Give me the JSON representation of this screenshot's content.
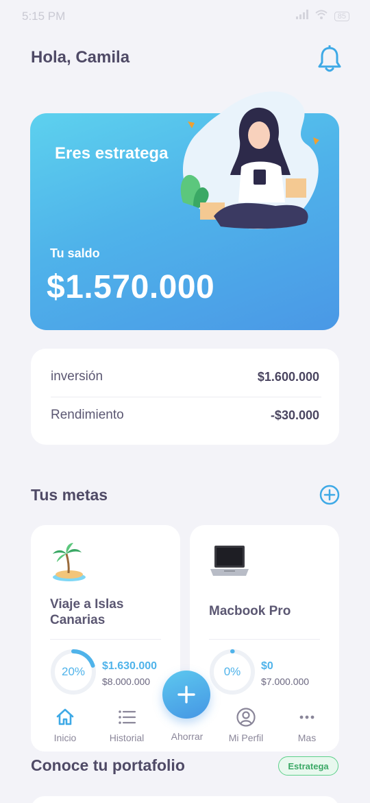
{
  "status": {
    "time": "5:15 PM",
    "battery": "85"
  },
  "header": {
    "greeting": "Hola, Camila"
  },
  "hero": {
    "title": "Eres estratega",
    "balance_label": "Tu saldo",
    "balance": "$1.570.000"
  },
  "summary": {
    "rows": [
      {
        "label": "inversión",
        "value": "$1.600.000"
      },
      {
        "label": "Rendimiento",
        "value": "-$30.000"
      }
    ]
  },
  "goals": {
    "title": "Tus metas",
    "items": [
      {
        "name": "Viaje a Islas Canarias",
        "icon": "island-icon",
        "percent": "20%",
        "progress": 0.2,
        "saved": "$1.630.000",
        "target": "$8.000.000"
      },
      {
        "name": "Macbook Pro",
        "icon": "laptop-icon",
        "percent": "0%",
        "progress": 0,
        "saved": "$0",
        "target": "$7.000.000"
      }
    ]
  },
  "nav": {
    "items": [
      {
        "label": "Inicio",
        "icon": "home-icon"
      },
      {
        "label": "Historial",
        "icon": "list-icon"
      },
      {
        "label": "Ahorrar",
        "icon": "plus-icon"
      },
      {
        "label": "Mi Perfil",
        "icon": "profile-icon"
      },
      {
        "label": "Mas",
        "icon": "more-icon"
      }
    ]
  },
  "portfolio": {
    "title": "Conoce tu portafolio",
    "badge": "Estratega"
  },
  "colors": {
    "accent": "#4fb3ea",
    "primary_text": "#4f4a66",
    "badge_green": "#3aa865"
  }
}
